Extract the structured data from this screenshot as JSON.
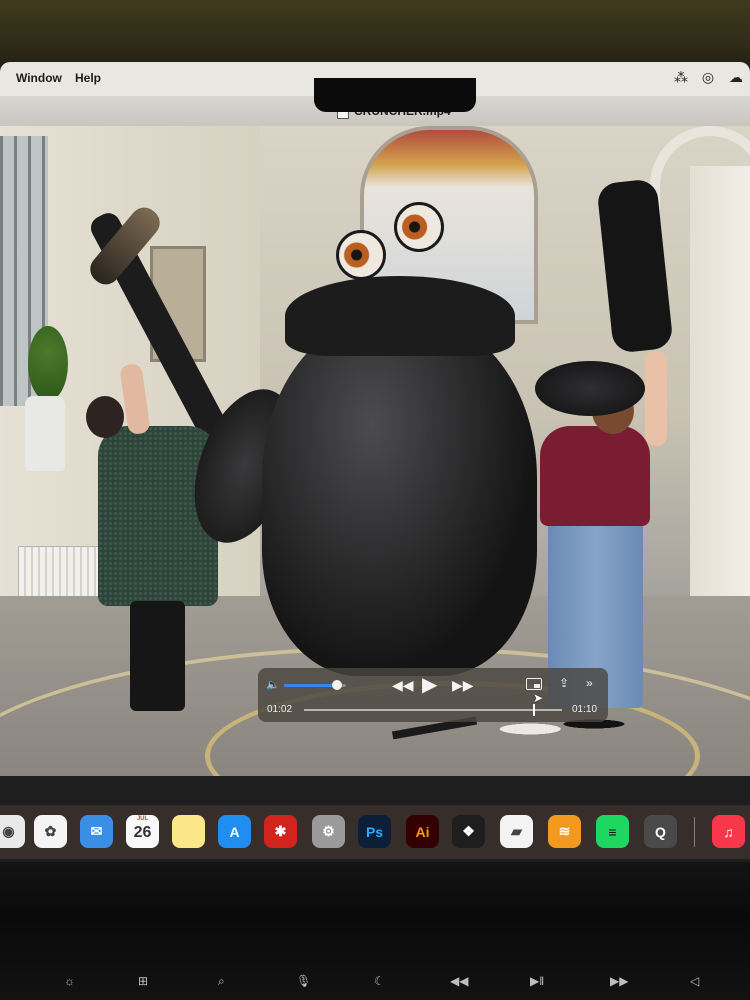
{
  "menubar": {
    "items": [
      "Window",
      "Help"
    ],
    "status_icons": [
      "control-strip-icon",
      "status-icon",
      "creative-cloud-icon"
    ]
  },
  "player": {
    "title": "CRUNCHER.mp4",
    "title_chevron": "⌄",
    "current_time": "01:02",
    "duration": "01:10",
    "progress_fraction": 0.886,
    "volume_fraction": 0.85,
    "controls": {
      "volume": "🔈",
      "rewind": "◀◀",
      "play": "▶",
      "fast_forward": "▶▶",
      "share": "⇪",
      "more": "»"
    }
  },
  "dock": {
    "apps": [
      {
        "name": "chrome",
        "glyph": "◉",
        "color": "#e9e9e9"
      },
      {
        "name": "photos",
        "glyph": "✿",
        "color": "#f4f4f4"
      },
      {
        "name": "mail",
        "glyph": "✉",
        "color": "#3a8ee6"
      },
      {
        "name": "calendar",
        "glyph": "",
        "color": "#f9f9f9"
      },
      {
        "name": "notes",
        "glyph": "",
        "color": "#fbe78a"
      },
      {
        "name": "app-store",
        "glyph": "A",
        "color": "#1f8ef0"
      },
      {
        "name": "acrobat",
        "glyph": "✱",
        "color": "#d1241d"
      },
      {
        "name": "system-settings",
        "glyph": "⚙",
        "color": "#9a9a9a"
      },
      {
        "name": "photoshop",
        "glyph": "Ps",
        "color": "#0c1f39"
      },
      {
        "name": "illustrator",
        "glyph": "Ai",
        "color": "#330000"
      },
      {
        "name": "figma",
        "glyph": "❖",
        "color": "#1e1e1e"
      },
      {
        "name": "monday",
        "glyph": "▰",
        "color": "#f3f3f3"
      },
      {
        "name": "audible",
        "glyph": "≋",
        "color": "#f39a1e"
      },
      {
        "name": "spotify",
        "glyph": "≡",
        "color": "#1ed760"
      },
      {
        "name": "quicktime",
        "glyph": "Q",
        "color": "#4a4a4a"
      },
      {
        "name": "music",
        "glyph": "♫",
        "color": "#f7384b"
      }
    ],
    "calendar": {
      "month": "JUL",
      "day": "26"
    }
  },
  "keyboard": {
    "keys": [
      "☼",
      "⊞",
      "⌕",
      "🎙",
      "☾",
      "◀◀",
      "▶‖",
      "▶▶",
      "◁"
    ]
  }
}
